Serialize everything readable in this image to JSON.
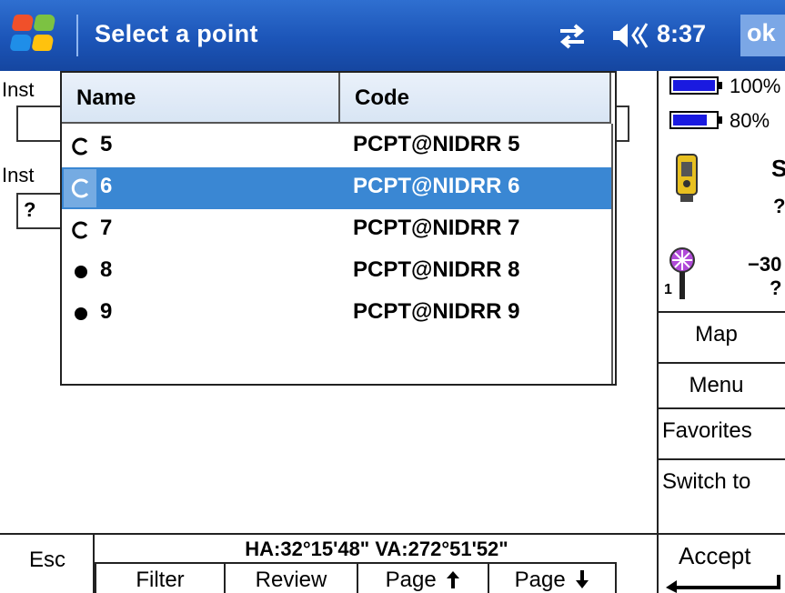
{
  "titlebar": {
    "title": "Select a point",
    "time": "8:37",
    "ok_label": "ok",
    "icons": [
      "windows-start-icon",
      "connectivity-icon",
      "volume-icon"
    ]
  },
  "background_form": {
    "label_1": "Inst",
    "label_2": "Inst",
    "field_2_value": "?"
  },
  "point_list": {
    "columns": [
      "Name",
      "Code"
    ],
    "selected_index": 1,
    "rows": [
      {
        "marker": "hollow-circle",
        "name": "5",
        "code": "PCPT@NIDRR 5"
      },
      {
        "marker": "hollow-circle",
        "name": "6",
        "code": "PCPT@NIDRR 6"
      },
      {
        "marker": "hollow-circle",
        "name": "7",
        "code": "PCPT@NIDRR 7"
      },
      {
        "marker": "filled-dot",
        "name": "8",
        "code": "PCPT@NIDRR 8"
      },
      {
        "marker": "filled-dot",
        "name": "9",
        "code": "PCPT@NIDRR 9"
      }
    ]
  },
  "status_panel": {
    "battery_1": "100%",
    "battery_1_level": 1.0,
    "battery_2": "80%",
    "battery_2_level": 0.8,
    "instrument_letter": "S",
    "instrument_value": "?",
    "target_value": "−30",
    "target_value_2": "?",
    "target_number": "1"
  },
  "side_buttons": {
    "map": "Map",
    "menu": "Menu",
    "favorites": "Favorites",
    "switch_to": "Switch to",
    "accept": "Accept"
  },
  "bottom_bar": {
    "esc": "Esc",
    "angles": "HA:32°15'48\"  VA:272°51'52\"",
    "filter": "Filter",
    "review": "Review",
    "page_up": "Page",
    "page_down": "Page"
  },
  "colors": {
    "titlebar": "#1c55b8",
    "selection": "#3a87d3",
    "battery": "#1a1ae0",
    "header": "#dce8f5"
  }
}
